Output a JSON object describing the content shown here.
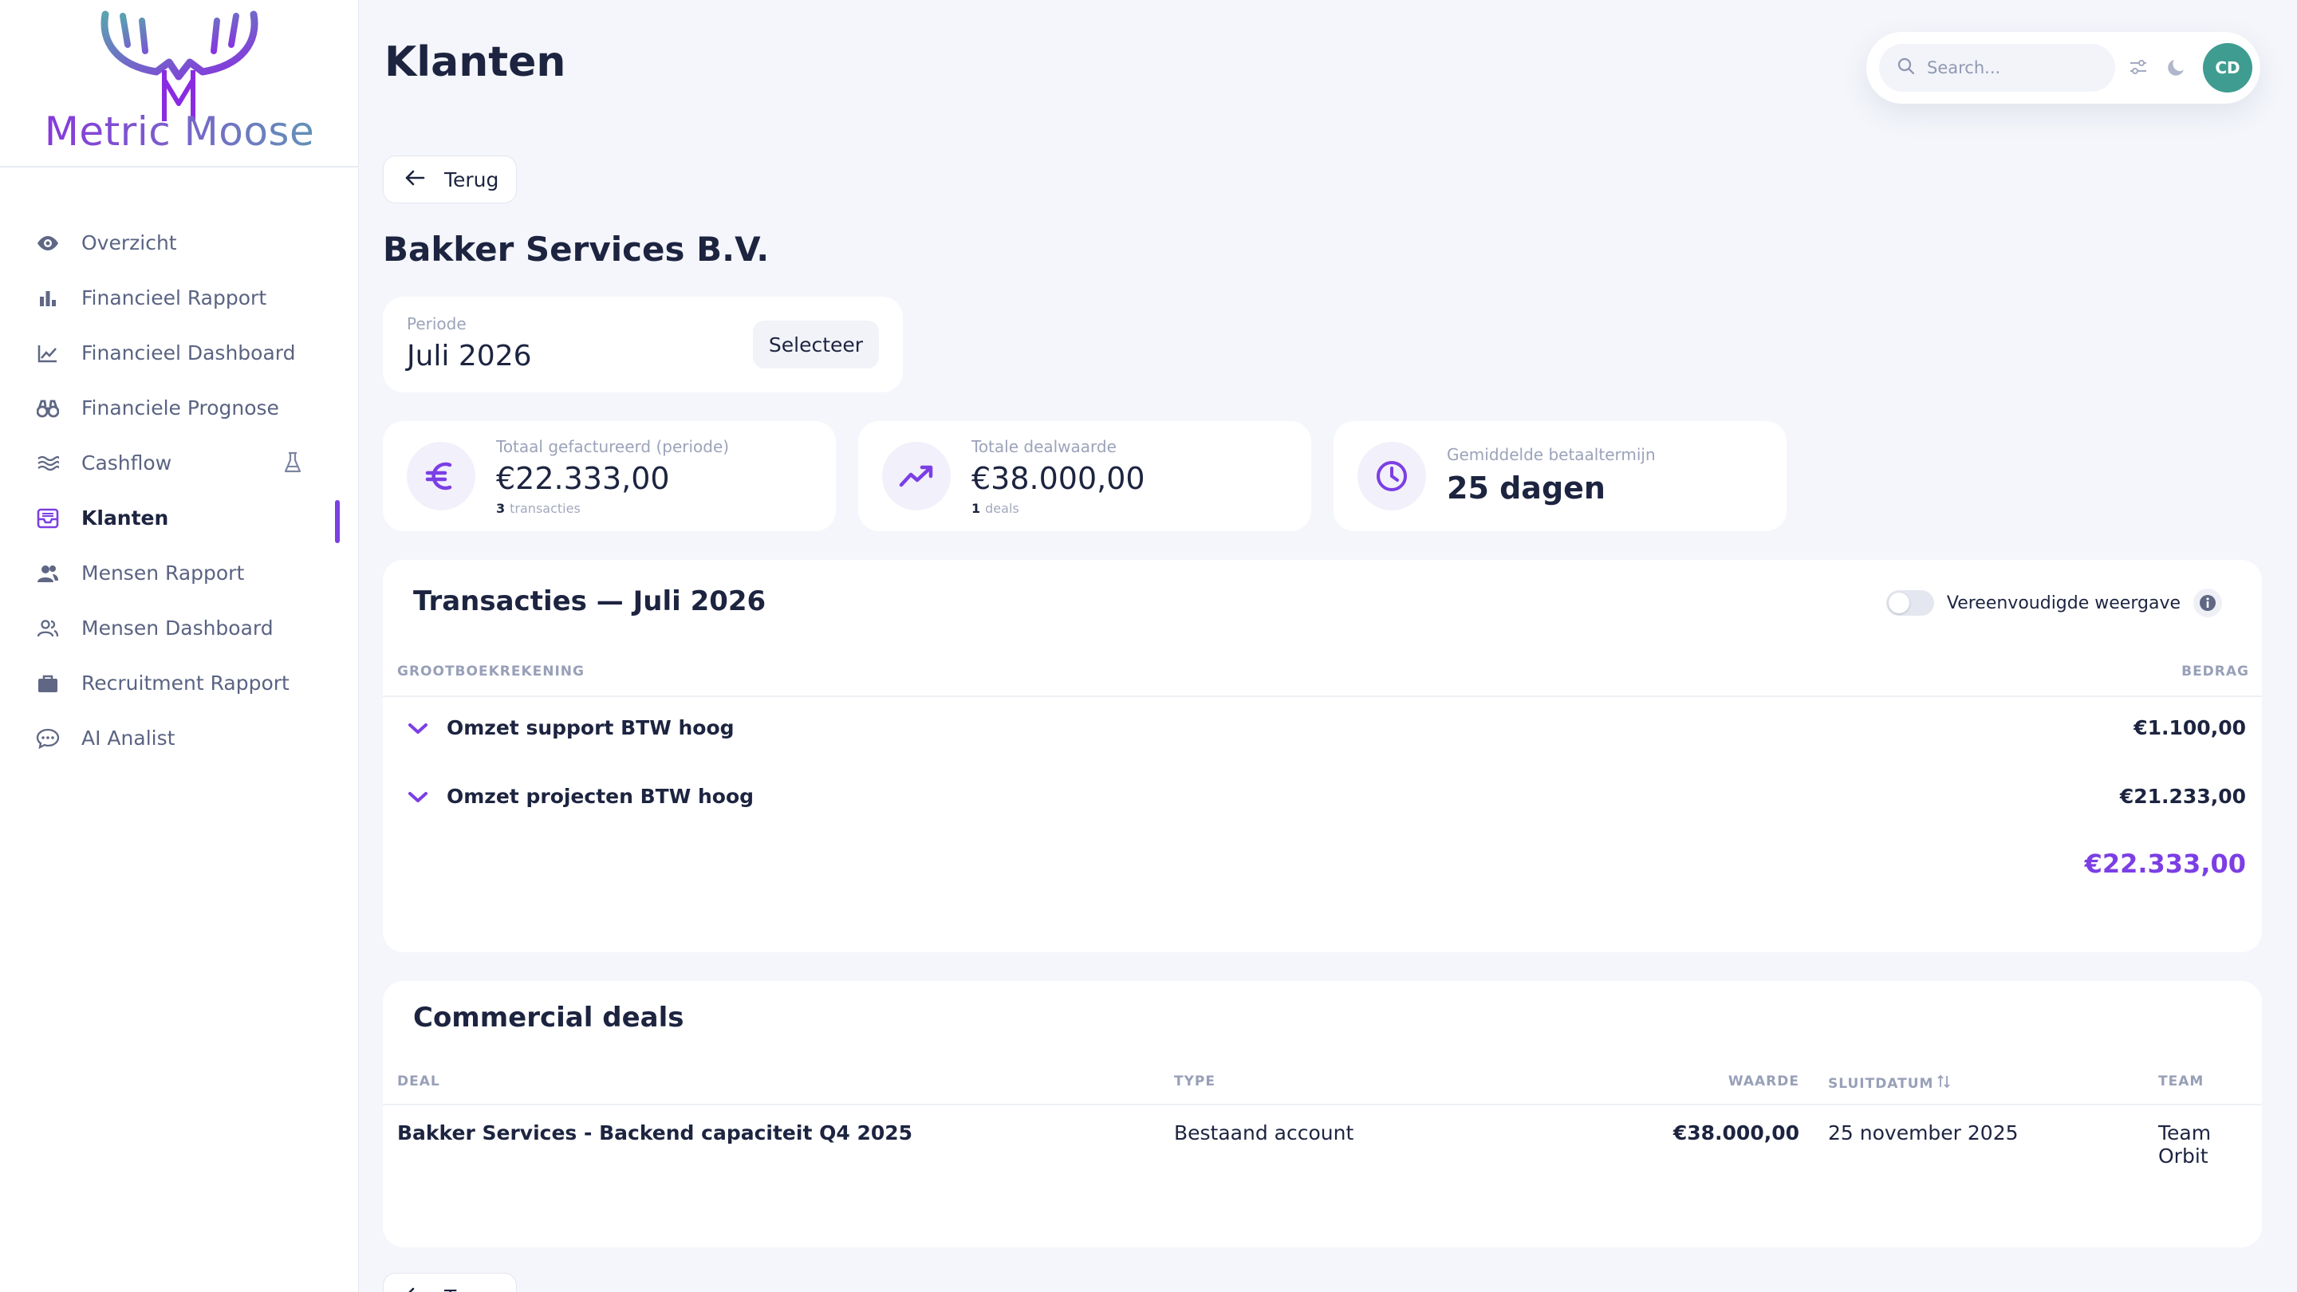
{
  "brand": {
    "name": "Metric Moose",
    "gradient": [
      "#8a2be2",
      "#5aa2b0"
    ]
  },
  "sidebar": {
    "items": [
      {
        "label": "Overzicht",
        "icon": "eye-icon"
      },
      {
        "label": "Financieel Rapport",
        "icon": "bar-chart-icon"
      },
      {
        "label": "Financieel Dashboard",
        "icon": "line-chart-icon"
      },
      {
        "label": "Financiele Prognose",
        "icon": "binoculars-icon"
      },
      {
        "label": "Cashflow",
        "icon": "waves-icon",
        "badge_icon": "flask-icon"
      },
      {
        "label": "Klanten",
        "icon": "inbox-icon",
        "active": true
      },
      {
        "label": "Mensen Rapport",
        "icon": "users-icon"
      },
      {
        "label": "Mensen Dashboard",
        "icon": "users-outline-icon"
      },
      {
        "label": "Recruitment Rapport",
        "icon": "briefcase-icon"
      },
      {
        "label": "AI Analist",
        "icon": "chat-icon"
      }
    ]
  },
  "header": {
    "title": "Klanten",
    "search_placeholder": "Search...",
    "avatar_initials": "CD",
    "avatar_color": "#3e9d90"
  },
  "back_label": "Terug",
  "client": {
    "name": "Bakker Services B.V."
  },
  "period": {
    "label": "Periode",
    "value": "Juli 2026",
    "select_label": "Selecteer"
  },
  "stats": [
    {
      "label": "Totaal gefactureerd (periode)",
      "value": "€22.333,00",
      "sub_count": "3",
      "sub_text": "transacties",
      "icon": "euro-icon"
    },
    {
      "label": "Totale dealwaarde",
      "value": "€38.000,00",
      "sub_count": "1",
      "sub_text": "deals",
      "icon": "trending-up-icon"
    },
    {
      "label": "Gemiddelde betaaltermijn",
      "value": "25 dagen",
      "icon": "clock-icon"
    }
  ],
  "transactions": {
    "title": "Transacties — Juli 2026",
    "toggle_label": "Vereenvoudigde weergave",
    "col_account": "GROOTBOEKREKENING",
    "col_amount": "BEDRAG",
    "rows": [
      {
        "label": "Omzet support BTW hoog",
        "amount": "€1.100,00"
      },
      {
        "label": "Omzet projecten BTW hoog",
        "amount": "€21.233,00"
      }
    ],
    "total": "€22.333,00"
  },
  "deals": {
    "title": "Commercial deals",
    "columns": {
      "deal": "DEAL",
      "type": "TYPE",
      "value": "WAARDE",
      "close_date": "SLUITDATUM",
      "team": "TEAM"
    },
    "rows": [
      {
        "deal": "Bakker Services - Backend capaciteit Q4 2025",
        "type": "Bestaand account",
        "value": "€38.000,00",
        "close_date": "25 november 2025",
        "team": "Team Orbit"
      }
    ]
  },
  "colors": {
    "accent": "#7b3fe4",
    "text": "#1d2440",
    "muted": "#9ca3ba",
    "background": "#f4f6fb"
  }
}
